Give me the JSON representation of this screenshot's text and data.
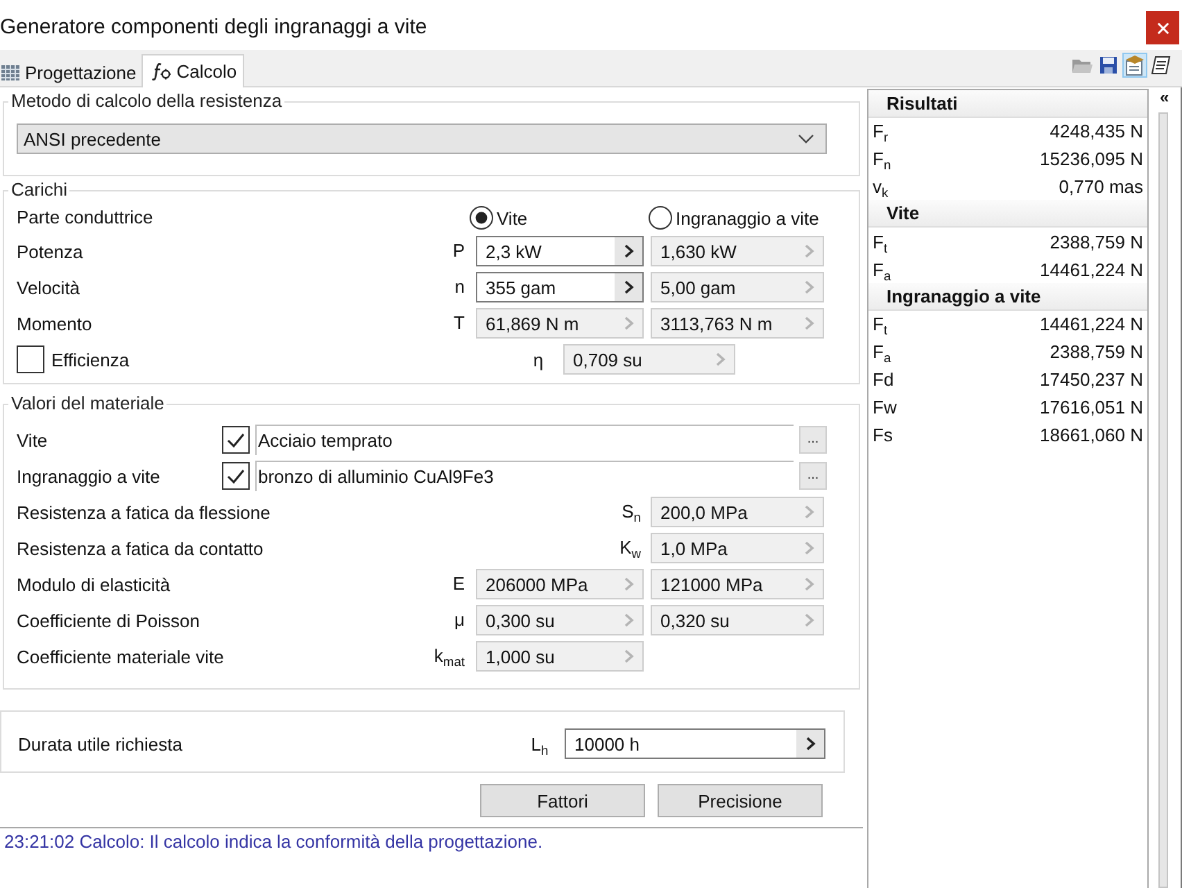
{
  "window": {
    "title": "Generatore componenti degli ingranaggi a vite"
  },
  "tabs": [
    {
      "label": "Progettazione",
      "kind": "design",
      "selected": false
    },
    {
      "label": "Calcolo",
      "kind": "calculation",
      "selected": true
    }
  ],
  "toolbar": [
    {
      "kind": "folder",
      "selected": false
    },
    {
      "kind": "disk",
      "selected": false
    },
    {
      "kind": "cap",
      "selected": true
    },
    {
      "kind": "notepad",
      "selected": false
    }
  ],
  "method_group": {
    "title": "Metodo di calcolo della resistenza",
    "dropdown": {
      "value": "ANSI precedente"
    }
  },
  "loads_group": {
    "title": "Carichi",
    "driver": {
      "label": "Parte conduttrice",
      "options": [
        {
          "label": "Vite",
          "selected": true
        },
        {
          "label": "Ingranaggio a vite",
          "selected": false
        }
      ]
    },
    "rows": [
      {
        "label": "Potenza",
        "symbol": "P",
        "left_field": {
          "value": "2,3 kW",
          "disabled": false
        },
        "right_field": {
          "value": "1,630 kW",
          "disabled": true
        }
      },
      {
        "label": "Velocità",
        "symbol": "n",
        "left_field": {
          "value": "355 gam",
          "disabled": false
        },
        "right_field": {
          "value": "5,00 gam",
          "disabled": true
        }
      },
      {
        "label": "Momento",
        "symbol": "T",
        "left_field": {
          "value": "61,869 N m",
          "disabled": true
        },
        "right_field": {
          "value": "3113,763 N m",
          "disabled": true
        }
      }
    ],
    "efficiency": {
      "label": "Efficienza",
      "checked": false,
      "symbol": "η",
      "field": {
        "value": "0,709 su",
        "disabled": true
      }
    }
  },
  "material_group": {
    "title": "Valori del materiale",
    "materials": [
      {
        "label": "Vite",
        "checked": true,
        "value": "Acciaio temprato",
        "button": "..."
      },
      {
        "label": "Ingranaggio a vite",
        "checked": true,
        "value": "bronzo di alluminio CuAl9Fe3",
        "button": "..."
      }
    ],
    "rows": [
      {
        "label": "Resistenza a fatica da flessione",
        "symbol": "S$_{n}$",
        "right_field": {
          "value": "200,0 MPa",
          "disabled": true
        }
      },
      {
        "label": "Resistenza a fatica da contatto",
        "symbol": "K$_{w}$",
        "right_field": {
          "value": "1,0 MPa",
          "disabled": true
        }
      },
      {
        "label": "Modulo di elasticità",
        "symbol": "E",
        "left_field": {
          "value": "206000 MPa",
          "disabled": true
        },
        "right_field": {
          "value": "121000 MPa",
          "disabled": true
        }
      },
      {
        "label": "Coefficiente di Poisson",
        "symbol": "μ",
        "left_field": {
          "value": "0,300 su",
          "disabled": true
        },
        "right_field": {
          "value": "0,320 su",
          "disabled": true
        }
      },
      {
        "label": "Coefficiente materiale vite",
        "symbol": "k$_{mat}$",
        "left_field": {
          "value": "1,000 su",
          "disabled": true
        }
      }
    ]
  },
  "life_group": {
    "label": "Durata utile richiesta",
    "symbol": "L$_{h}$",
    "field": {
      "value": "10000 h",
      "disabled": false
    }
  },
  "buttons": [
    "Fattori",
    "Precisione"
  ],
  "log": {
    "message": "23:21:02 Calcolo: Il calcolo indica la conformità della progettazione."
  },
  "results": {
    "sections": [
      {
        "heading": "Risultati",
        "rows": [
          {
            "label": "F$_{r}$",
            "value": "4248,435 N"
          },
          {
            "label": "F$_{n}$",
            "value": "15236,095 N"
          },
          {
            "label": "v$_{k}$",
            "value": "0,770 mas"
          }
        ]
      },
      {
        "heading": "Vite",
        "rows": [
          {
            "label": "F$_{t}$",
            "value": "2388,759 N"
          },
          {
            "label": "F$_{a}$",
            "value": "14461,224 N"
          }
        ]
      },
      {
        "heading": "Ingranaggio a vite",
        "rows": [
          {
            "label": "F$_{t}$",
            "value": "14461,224 N"
          },
          {
            "label": "F$_{a}$",
            "value": "2388,759 N"
          },
          {
            "label": "Fd",
            "value": "17450,237 N"
          },
          {
            "label": "Fw",
            "value": "17616,051 N"
          },
          {
            "label": "Fs",
            "value": "18661,060 N"
          }
        ]
      }
    ]
  },
  "panel_toggle": {
    "label": "«"
  }
}
